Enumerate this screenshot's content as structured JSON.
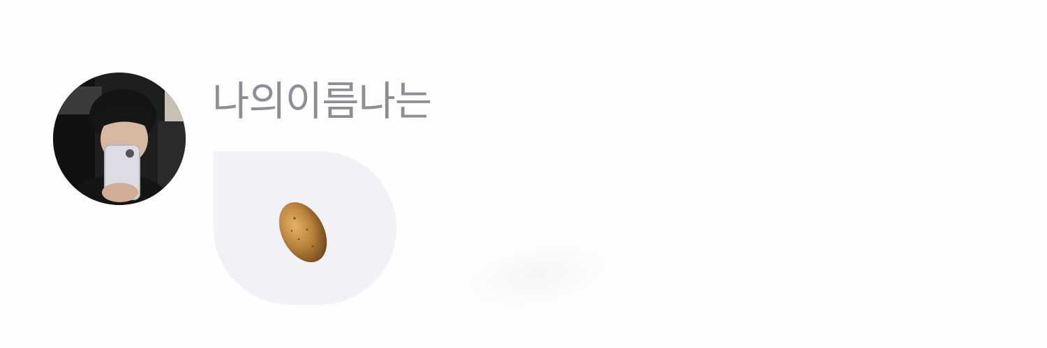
{
  "message": {
    "sender_name": "나의이름나는",
    "avatar_icon": "profile-photo",
    "content_icon": "potato-emoji"
  },
  "colors": {
    "background": "#fefefe",
    "name_text": "#8e8e96",
    "bubble": "#f2f1f5"
  }
}
